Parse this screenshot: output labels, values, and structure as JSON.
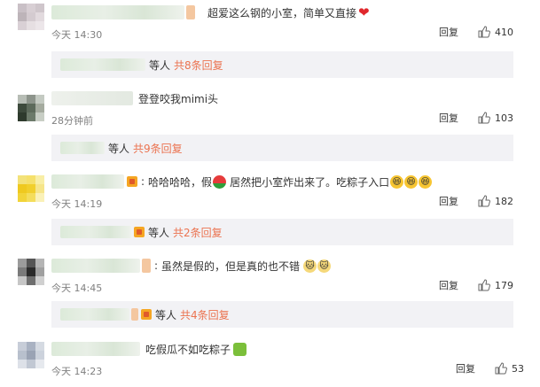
{
  "comments": [
    {
      "text": "超爱这么钢的小室，简单又直接",
      "time": "今天 14:30",
      "reply_label": "回复",
      "likes": "410",
      "replies": {
        "people": "等人",
        "count": "共8条回复"
      }
    },
    {
      "text": "登登咬我mimi头",
      "time": "28分钟前",
      "reply_label": "回复",
      "likes": "103",
      "replies": {
        "people": "等人",
        "count": "共9条回复"
      }
    },
    {
      "text_a": "哈哈哈哈，假",
      "text_b": "居然把小室炸出来了。吃粽子入口",
      "time": "今天 14:19",
      "reply_label": "回复",
      "likes": "182",
      "replies": {
        "people": "等人",
        "count": "共2条回复"
      }
    },
    {
      "text": "虽然是假的，但是真的也不错",
      "time": "今天 14:45",
      "reply_label": "回复",
      "likes": "179",
      "replies": {
        "people": "等人",
        "count": "共4条回复"
      }
    },
    {
      "text": "吃假瓜不如吃粽子",
      "time": "今天 14:23",
      "reply_label": "回复",
      "likes": "53"
    }
  ],
  "colors": {
    "reply_count": "#eb7350",
    "timestamp": "#808080",
    "reply_bar_bg": "#f2f2f5"
  },
  "icons": [
    "heart-icon",
    "watermelon-icon",
    "laughing-face-icon",
    "cat-face-icon",
    "zongzi-icon",
    "thumbs-up-icon",
    "user-badge-icon"
  ]
}
